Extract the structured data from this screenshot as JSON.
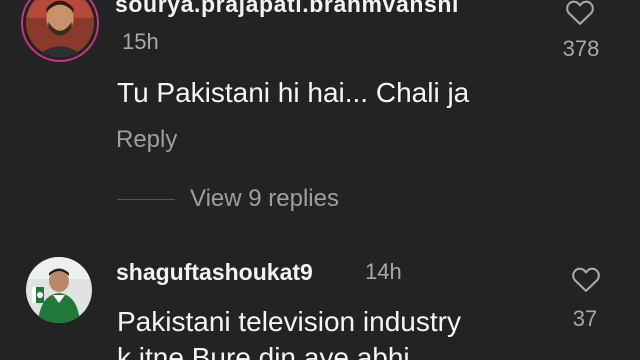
{
  "comments": [
    {
      "username": "sourya.prajapati.brahmvanshi",
      "time": "15h",
      "text": "Tu Pakistani hi hai... Chali ja",
      "reply_label": "Reply",
      "view_replies": "View 9 replies",
      "like_count": "378",
      "avatar": "profile-photo-man"
    },
    {
      "username": "shaguftashoukat9",
      "time": "14h",
      "text_line1": "Pakistani television industry",
      "text_line2": "k itne Bure din aye abhi",
      "like_count": "37",
      "avatar": "profile-photo-child"
    }
  ],
  "icons": {
    "like": "heart-outline-icon"
  },
  "colors": {
    "background": "#232323",
    "primary_text": "#f2f2f2",
    "secondary_text": "#a8a8a8",
    "story_ring": "#c6377f"
  }
}
